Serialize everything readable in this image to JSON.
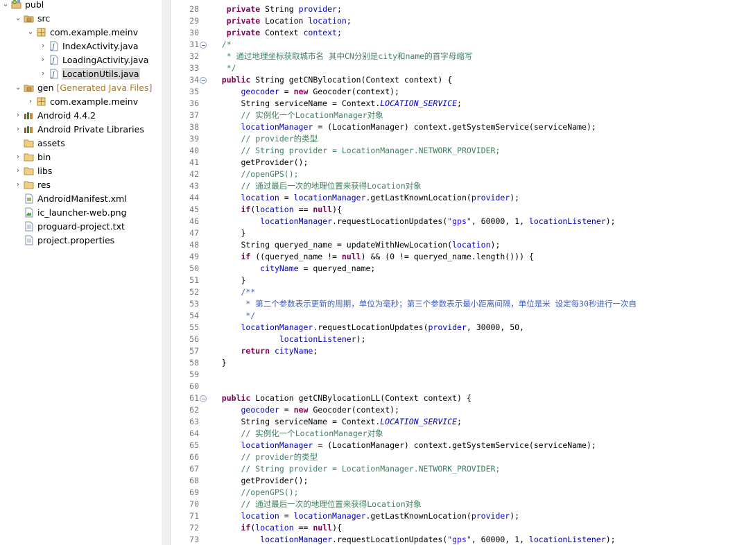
{
  "explorer": {
    "items": [
      {
        "label": "publ",
        "decoration": "",
        "depth": 0,
        "expanded": true,
        "twisty": "open",
        "icon": "project-icon"
      },
      {
        "label": "src",
        "decoration": "",
        "depth": 1,
        "expanded": true,
        "twisty": "open",
        "icon": "source-folder-icon"
      },
      {
        "label": "com.example.meinv",
        "decoration": "",
        "depth": 2,
        "expanded": true,
        "twisty": "open",
        "icon": "package-icon"
      },
      {
        "label": "IndexActivity.java",
        "decoration": "",
        "depth": 3,
        "twisty": "closed",
        "icon": "java-file-icon"
      },
      {
        "label": "LoadingActivity.java",
        "decoration": "",
        "depth": 3,
        "twisty": "closed",
        "icon": "java-file-icon"
      },
      {
        "label": "LocationUtils.java",
        "decoration": "",
        "depth": 3,
        "twisty": "closed",
        "icon": "java-file-icon",
        "selected": true
      },
      {
        "label": "gen",
        "decoration": "[Generated Java Files]",
        "depth": 1,
        "twisty": "open",
        "icon": "gen-folder-icon"
      },
      {
        "label": "com.example.meinv",
        "decoration": "",
        "depth": 2,
        "twisty": "closed",
        "icon": "package-icon"
      },
      {
        "label": "Android 4.4.2",
        "decoration": "",
        "depth": 1,
        "twisty": "closed",
        "icon": "library-icon"
      },
      {
        "label": "Android Private Libraries",
        "decoration": "",
        "depth": 1,
        "twisty": "closed",
        "icon": "library-icon"
      },
      {
        "label": "assets",
        "decoration": "",
        "depth": 1,
        "twisty": "none",
        "icon": "folder-icon"
      },
      {
        "label": "bin",
        "decoration": "",
        "depth": 1,
        "twisty": "closed",
        "icon": "folder-icon"
      },
      {
        "label": "libs",
        "decoration": "",
        "depth": 1,
        "twisty": "closed",
        "icon": "folder-icon"
      },
      {
        "label": "res",
        "decoration": "",
        "depth": 1,
        "twisty": "closed",
        "icon": "folder-icon"
      },
      {
        "label": "AndroidManifest.xml",
        "decoration": "",
        "depth": 1,
        "twisty": "none",
        "icon": "xml-file-icon"
      },
      {
        "label": "ic_launcher-web.png",
        "decoration": "",
        "depth": 1,
        "twisty": "none",
        "icon": "image-file-icon"
      },
      {
        "label": "proguard-project.txt",
        "decoration": "",
        "depth": 1,
        "twisty": "none",
        "icon": "text-file-icon"
      },
      {
        "label": "project.properties",
        "decoration": "",
        "depth": 1,
        "twisty": "none",
        "icon": "text-file-icon"
      }
    ]
  },
  "editor": {
    "lines": [
      {
        "n": "28",
        "fold": false,
        "t": [
          [
            "    ",
            ""
          ],
          [
            "private",
            "kw"
          ],
          [
            " String ",
            ""
          ],
          [
            "provider",
            "fld"
          ],
          [
            ";",
            ""
          ]
        ]
      },
      {
        "n": "29",
        "fold": false,
        "t": [
          [
            "    ",
            ""
          ],
          [
            "private",
            "kw"
          ],
          [
            " Location ",
            ""
          ],
          [
            "location",
            "fld"
          ],
          [
            ";",
            ""
          ]
        ]
      },
      {
        "n": "30",
        "fold": false,
        "t": [
          [
            "    ",
            ""
          ],
          [
            "private",
            "kw"
          ],
          [
            " Context ",
            ""
          ],
          [
            "context",
            "fld"
          ],
          [
            ";",
            ""
          ]
        ]
      },
      {
        "n": "31",
        "fold": true,
        "t": [
          [
            "   /*",
            "cm"
          ]
        ]
      },
      {
        "n": "32",
        "fold": false,
        "t": [
          [
            "    * 通过地理坐标获取城市名 其中CN分别是city和name的首字母缩写",
            "cm"
          ]
        ]
      },
      {
        "n": "33",
        "fold": false,
        "t": [
          [
            "    */",
            "cm"
          ]
        ]
      },
      {
        "n": "34",
        "fold": true,
        "t": [
          [
            "   ",
            ""
          ],
          [
            "public",
            "kw"
          ],
          [
            " String getCNBylocation(Context context) {",
            ""
          ]
        ]
      },
      {
        "n": "35",
        "fold": false,
        "t": [
          [
            "       ",
            ""
          ],
          [
            "geocoder",
            "fld"
          ],
          [
            " = ",
            ""
          ],
          [
            "new",
            "kw"
          ],
          [
            " Geocoder(context);",
            ""
          ]
        ]
      },
      {
        "n": "36",
        "fold": false,
        "t": [
          [
            "       String serviceName = Context.",
            ""
          ],
          [
            "LOCATION_SERVICE",
            "sfld"
          ],
          [
            ";",
            ""
          ]
        ]
      },
      {
        "n": "37",
        "fold": false,
        "t": [
          [
            "       // 实例化一个LocationManager对象",
            "cm"
          ]
        ]
      },
      {
        "n": "38",
        "fold": false,
        "t": [
          [
            "       ",
            ""
          ],
          [
            "locationManager",
            "fld"
          ],
          [
            " = (LocationManager) context.getSystemService(serviceName);",
            ""
          ]
        ]
      },
      {
        "n": "39",
        "fold": false,
        "t": [
          [
            "       // provider的类型",
            "cm"
          ]
        ]
      },
      {
        "n": "40",
        "fold": false,
        "t": [
          [
            "       // String provider = LocationManager.NETWORK_PROVIDER;",
            "cm"
          ]
        ]
      },
      {
        "n": "41",
        "fold": false,
        "t": [
          [
            "       getProvider();",
            ""
          ]
        ]
      },
      {
        "n": "42",
        "fold": false,
        "t": [
          [
            "       //openGPS();",
            "cm"
          ]
        ]
      },
      {
        "n": "43",
        "fold": false,
        "t": [
          [
            "       // 通过最后一次的地理位置来获得Location对象",
            "cm"
          ]
        ]
      },
      {
        "n": "44",
        "fold": false,
        "t": [
          [
            "       ",
            ""
          ],
          [
            "location",
            "fld"
          ],
          [
            " = ",
            ""
          ],
          [
            "locationManager",
            "fld"
          ],
          [
            ".getLastKnownLocation(",
            ""
          ],
          [
            "provider",
            "fld"
          ],
          [
            ");",
            ""
          ]
        ]
      },
      {
        "n": "45",
        "fold": false,
        "t": [
          [
            "       ",
            ""
          ],
          [
            "if",
            "kw"
          ],
          [
            "(",
            ""
          ],
          [
            "location",
            "fld"
          ],
          [
            " == ",
            ""
          ],
          [
            "null",
            "kw"
          ],
          [
            "){",
            ""
          ]
        ]
      },
      {
        "n": "46",
        "fold": false,
        "t": [
          [
            "           ",
            ""
          ],
          [
            "locationManager",
            "fld"
          ],
          [
            ".requestLocationUpdates(",
            ""
          ],
          [
            "\"gps\"",
            "str"
          ],
          [
            ", 60000, 1, ",
            ""
          ],
          [
            "locationListener",
            "fld"
          ],
          [
            ");",
            ""
          ]
        ]
      },
      {
        "n": "47",
        "fold": false,
        "t": [
          [
            "       }",
            ""
          ]
        ]
      },
      {
        "n": "48",
        "fold": false,
        "t": [
          [
            "       String queryed_name = updateWithNewLocation(",
            ""
          ],
          [
            "location",
            "fld"
          ],
          [
            ");",
            ""
          ]
        ]
      },
      {
        "n": "49",
        "fold": false,
        "t": [
          [
            "       ",
            ""
          ],
          [
            "if",
            "kw"
          ],
          [
            " ((queryed_name != ",
            ""
          ],
          [
            "null",
            "kw"
          ],
          [
            ") && (0 != queryed_name.length())) {",
            ""
          ]
        ]
      },
      {
        "n": "50",
        "fold": false,
        "t": [
          [
            "           ",
            ""
          ],
          [
            "cityName",
            "fld"
          ],
          [
            " = queryed_name;",
            ""
          ]
        ]
      },
      {
        "n": "51",
        "fold": false,
        "t": [
          [
            "       }",
            ""
          ]
        ]
      },
      {
        "n": "52",
        "fold": false,
        "t": [
          [
            "       /**",
            "jd"
          ]
        ]
      },
      {
        "n": "53",
        "fold": false,
        "t": [
          [
            "        * 第二个参数表示更新的周期，单位为毫秒；第三个参数表示最小距离间隔，单位是米 设定每30秒进行一次自",
            "jd"
          ]
        ]
      },
      {
        "n": "54",
        "fold": false,
        "t": [
          [
            "        */",
            "jd"
          ]
        ]
      },
      {
        "n": "55",
        "fold": false,
        "t": [
          [
            "       ",
            ""
          ],
          [
            "locationManager",
            "fld"
          ],
          [
            ".requestLocationUpdates(",
            ""
          ],
          [
            "provider",
            "fld"
          ],
          [
            ", 30000, 50,",
            ""
          ]
        ]
      },
      {
        "n": "56",
        "fold": false,
        "t": [
          [
            "               ",
            ""
          ],
          [
            "locationListener",
            "fld"
          ],
          [
            ");",
            ""
          ]
        ]
      },
      {
        "n": "57",
        "fold": false,
        "t": [
          [
            "       ",
            ""
          ],
          [
            "return",
            "kw"
          ],
          [
            " ",
            ""
          ],
          [
            "cityName",
            "fld"
          ],
          [
            ";",
            ""
          ]
        ]
      },
      {
        "n": "58",
        "fold": false,
        "t": [
          [
            "   }",
            ""
          ]
        ]
      },
      {
        "n": "59",
        "fold": false,
        "t": [
          [
            "",
            ""
          ]
        ]
      },
      {
        "n": "60",
        "fold": false,
        "t": [
          [
            "",
            ""
          ]
        ]
      },
      {
        "n": "61",
        "fold": true,
        "t": [
          [
            "   ",
            ""
          ],
          [
            "public",
            "kw"
          ],
          [
            " Location getCNBylocationLL(Context context) {",
            ""
          ]
        ]
      },
      {
        "n": "62",
        "fold": false,
        "t": [
          [
            "       ",
            ""
          ],
          [
            "geocoder",
            "fld"
          ],
          [
            " = ",
            ""
          ],
          [
            "new",
            "kw"
          ],
          [
            " Geocoder(context);",
            ""
          ]
        ]
      },
      {
        "n": "63",
        "fold": false,
        "t": [
          [
            "       String serviceName = Context.",
            ""
          ],
          [
            "LOCATION_SERVICE",
            "sfld"
          ],
          [
            ";",
            ""
          ]
        ]
      },
      {
        "n": "64",
        "fold": false,
        "t": [
          [
            "       // 实例化一个LocationManager对象",
            "cm"
          ]
        ]
      },
      {
        "n": "65",
        "fold": false,
        "t": [
          [
            "       ",
            ""
          ],
          [
            "locationManager",
            "fld"
          ],
          [
            " = (LocationManager) context.getSystemService(serviceName);",
            ""
          ]
        ]
      },
      {
        "n": "66",
        "fold": false,
        "t": [
          [
            "       // provider的类型",
            "cm"
          ]
        ]
      },
      {
        "n": "67",
        "fold": false,
        "t": [
          [
            "       // String provider = LocationManager.NETWORK_PROVIDER;",
            "cm"
          ]
        ]
      },
      {
        "n": "68",
        "fold": false,
        "t": [
          [
            "       getProvider();",
            ""
          ]
        ]
      },
      {
        "n": "69",
        "fold": false,
        "t": [
          [
            "       //openGPS();",
            "cm"
          ]
        ]
      },
      {
        "n": "70",
        "fold": false,
        "t": [
          [
            "       // 通过最后一次的地理位置来获得Location对象",
            "cm"
          ]
        ]
      },
      {
        "n": "71",
        "fold": false,
        "t": [
          [
            "       ",
            ""
          ],
          [
            "location",
            "fld"
          ],
          [
            " = ",
            ""
          ],
          [
            "locationManager",
            "fld"
          ],
          [
            ".getLastKnownLocation(",
            ""
          ],
          [
            "provider",
            "fld"
          ],
          [
            ");",
            ""
          ]
        ]
      },
      {
        "n": "72",
        "fold": false,
        "t": [
          [
            "       ",
            ""
          ],
          [
            "if",
            "kw"
          ],
          [
            "(",
            ""
          ],
          [
            "location",
            "fld"
          ],
          [
            " == ",
            ""
          ],
          [
            "null",
            "kw"
          ],
          [
            "){",
            ""
          ]
        ]
      },
      {
        "n": "73",
        "fold": false,
        "t": [
          [
            "           ",
            ""
          ],
          [
            "locationManager",
            "fld"
          ],
          [
            ".requestLocationUpdates(",
            ""
          ],
          [
            "\"gps\"",
            "str"
          ],
          [
            ", 60000, 1, ",
            ""
          ],
          [
            "locationListener",
            "fld"
          ],
          [
            ");",
            ""
          ]
        ]
      }
    ]
  }
}
